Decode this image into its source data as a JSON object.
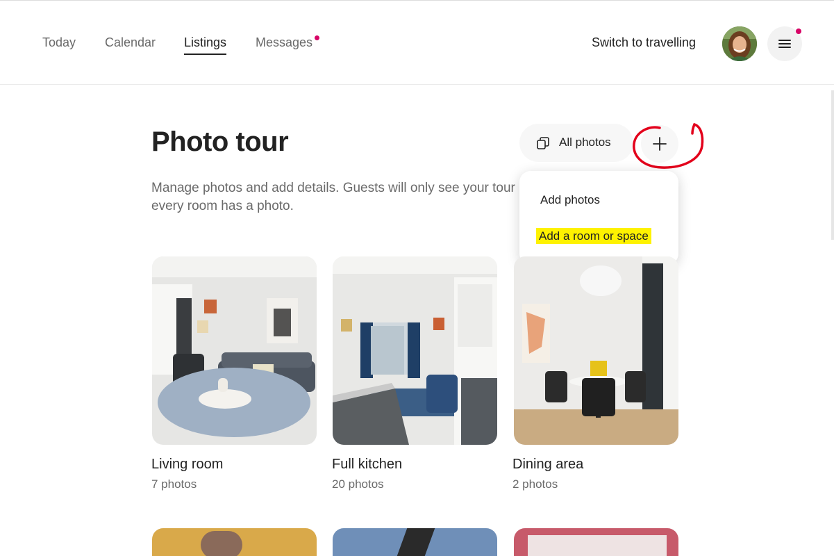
{
  "nav": {
    "tabs": [
      {
        "label": "Today"
      },
      {
        "label": "Calendar"
      },
      {
        "label": "Listings"
      },
      {
        "label": "Messages"
      }
    ],
    "switch_label": "Switch to travelling"
  },
  "colors": {
    "notification_dot": "#d70466",
    "highlight": "#fef200",
    "annotation_circle": "#e3001b"
  },
  "page": {
    "title": "Photo tour",
    "subtitle": "Manage photos and add details. Guests will only see your tour if every room has a photo."
  },
  "actions": {
    "all_photos_label": "All photos"
  },
  "dropdown": {
    "items": [
      {
        "label": "Add photos"
      },
      {
        "label": "Add a room or space"
      }
    ]
  },
  "rooms": [
    {
      "name": "Living room",
      "count": "7 photos"
    },
    {
      "name": "Full kitchen",
      "count": "20 photos"
    },
    {
      "name": "Dining area",
      "count": "2 photos"
    }
  ]
}
